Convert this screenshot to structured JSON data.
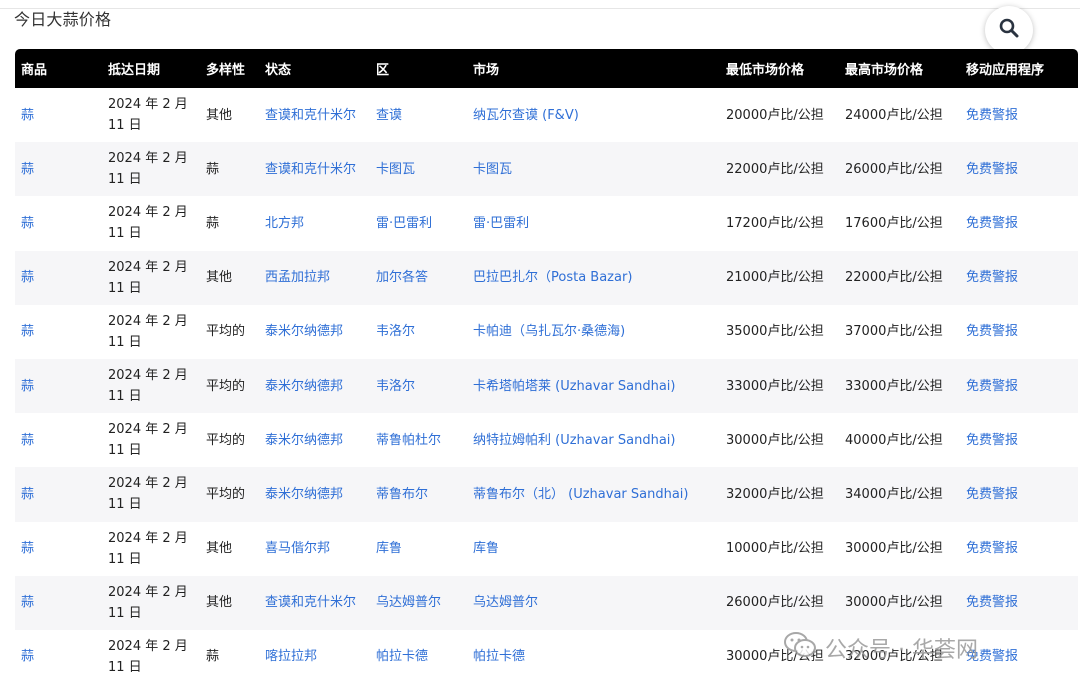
{
  "page": {
    "title": "今日大蒜价格"
  },
  "search": {
    "icon": "search-icon"
  },
  "table": {
    "headers": [
      "商品",
      "抵达日期",
      "多样性",
      "状态",
      "区",
      "市场",
      "最低市场价格",
      "最高市场价格",
      "移动应用程序"
    ],
    "rows": [
      [
        "蒜",
        "2024 年 2 月 11 日",
        "其他",
        "查谟和克什米尔",
        "查谟",
        "纳瓦尔查谟 (F&V)",
        "20000卢比/公担",
        "24000卢比/公担",
        "免费警报"
      ],
      [
        "蒜",
        "2024 年 2 月 11 日",
        "蒜",
        "查谟和克什米尔",
        "卡图瓦",
        "卡图瓦",
        "22000卢比/公担",
        "26000卢比/公担",
        "免费警报"
      ],
      [
        "蒜",
        "2024 年 2 月 11 日",
        "蒜",
        "北方邦",
        "雷·巴雷利",
        "雷·巴雷利",
        "17200卢比/公担",
        "17600卢比/公担",
        "免费警报"
      ],
      [
        "蒜",
        "2024 年 2 月 11 日",
        "其他",
        "西孟加拉邦",
        "加尔各答",
        "巴拉巴扎尔（Posta Bazar)",
        "21000卢比/公担",
        "22000卢比/公担",
        "免费警报"
      ],
      [
        "蒜",
        "2024 年 2 月 11 日",
        "平均的",
        "泰米尔纳德邦",
        "韦洛尔",
        "卡帕迪（乌扎瓦尔·桑德海)",
        "35000卢比/公担",
        "37000卢比/公担",
        "免费警报"
      ],
      [
        "蒜",
        "2024 年 2 月 11 日",
        "平均的",
        "泰米尔纳德邦",
        "韦洛尔",
        "卡希塔帕塔莱 (Uzhavar Sandhai)",
        "33000卢比/公担",
        "33000卢比/公担",
        "免费警报"
      ],
      [
        "蒜",
        "2024 年 2 月 11 日",
        "平均的",
        "泰米尔纳德邦",
        "蒂鲁帕杜尔",
        "纳特拉姆帕利 (Uzhavar Sandhai)",
        "30000卢比/公担",
        "40000卢比/公担",
        "免费警报"
      ],
      [
        "蒜",
        "2024 年 2 月 11 日",
        "平均的",
        "泰米尔纳德邦",
        "蒂鲁布尔",
        "蒂鲁布尔（北） (Uzhavar Sandhai)",
        "32000卢比/公担",
        "34000卢比/公担",
        "免费警报"
      ],
      [
        "蒜",
        "2024 年 2 月 11 日",
        "其他",
        "喜马偕尔邦",
        "库鲁",
        "库鲁",
        "10000卢比/公担",
        "30000卢比/公担",
        "免费警报"
      ],
      [
        "蒜",
        "2024 年 2 月 11 日",
        "其他",
        "查谟和克什米尔",
        "乌达姆普尔",
        "乌达姆普尔",
        "26000卢比/公担",
        "30000卢比/公担",
        "免费警报"
      ],
      [
        "蒜",
        "2024 年 2 月 11 日",
        "蒜",
        "喀拉拉邦",
        "帕拉卡德",
        "帕拉卡德",
        "30000卢比/公担",
        "32000卢比/公担",
        "免费警报"
      ]
    ]
  },
  "watermark": {
    "text": "公众号 · 华荟网"
  },
  "colors": {
    "link": "#2f6fd6",
    "header_bg": "#000000",
    "row_alt": "#f6f6f8"
  }
}
